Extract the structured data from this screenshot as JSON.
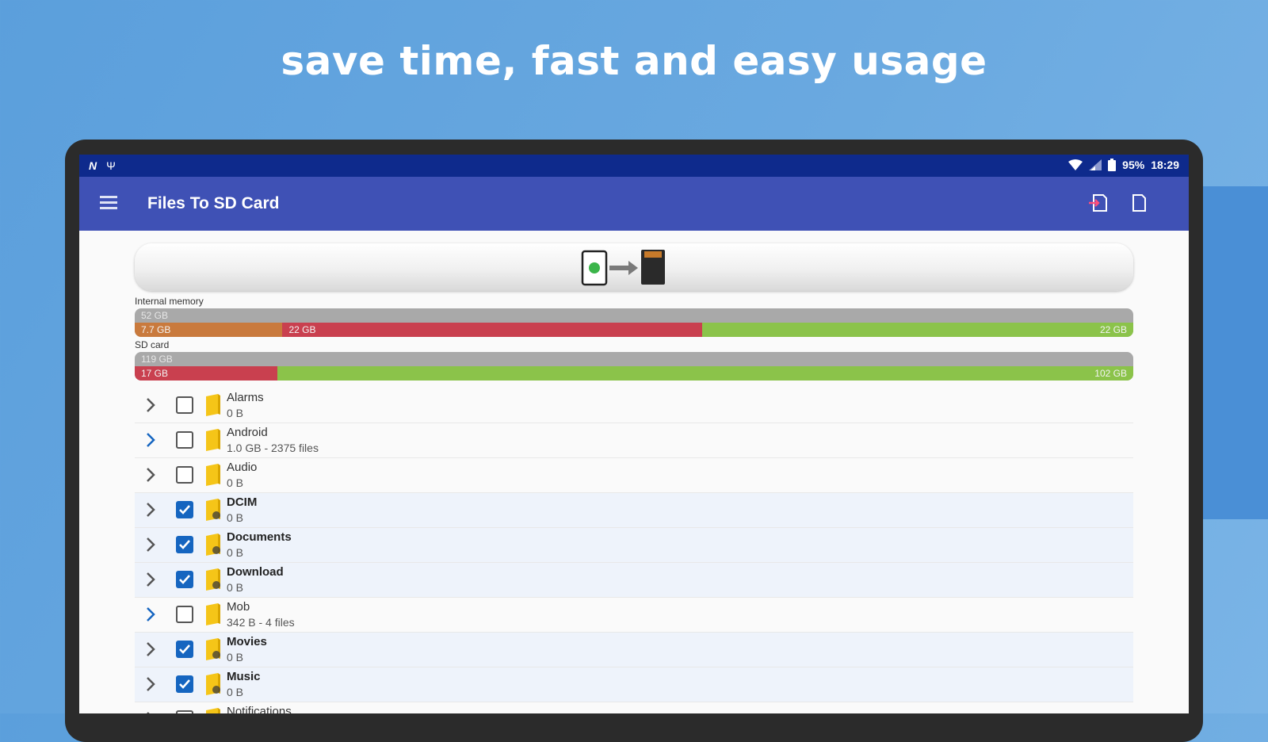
{
  "headline": "save time, fast and easy usage",
  "statusbar": {
    "battery": "95%",
    "time": "18:29",
    "icons": [
      "n-icon",
      "usb-icon",
      "wifi-icon",
      "signal-icon",
      "battery-icon"
    ]
  },
  "appbar": {
    "title": "Files To SD Card",
    "icons": [
      "menu-icon",
      "move-to-sd-icon",
      "sd-card-icon"
    ]
  },
  "colors": {
    "status_bar": "#0e2a8c",
    "app_bar": "#3f51b5",
    "used_other": "#c97a3d",
    "used": "#c9404f",
    "free": "#8bc34a",
    "checkbox_on": "#1565c0",
    "chevron_active": "#1565c0",
    "folder": "#f5c518"
  },
  "storage": {
    "internal": {
      "label": "Internal memory",
      "total": "52 GB",
      "segments": [
        {
          "label": "7.7 GB",
          "fraction": 0.148,
          "kind": "other"
        },
        {
          "label": "22 GB",
          "fraction": 0.42,
          "kind": "used"
        },
        {
          "label": "22 GB",
          "fraction": 0.432,
          "kind": "free"
        }
      ]
    },
    "sd": {
      "label": "SD card",
      "total": "119 GB",
      "segments": [
        {
          "label": "17 GB",
          "fraction": 0.143,
          "kind": "used"
        },
        {
          "label": "102 GB",
          "fraction": 0.857,
          "kind": "free"
        }
      ]
    }
  },
  "folders": [
    {
      "name": "Alarms",
      "size": "0 B",
      "checked": false,
      "expandable": false,
      "badge": ""
    },
    {
      "name": "Android",
      "size": "1.0 GB - 2375 files",
      "checked": false,
      "expandable": true,
      "badge": ""
    },
    {
      "name": "Audio",
      "size": "0 B",
      "checked": false,
      "expandable": false,
      "badge": ""
    },
    {
      "name": "DCIM",
      "size": "0 B",
      "checked": true,
      "expandable": false,
      "badge": "camera"
    },
    {
      "name": "Documents",
      "size": "0 B",
      "checked": true,
      "expandable": false,
      "badge": "document"
    },
    {
      "name": "Download",
      "size": "0 B",
      "checked": true,
      "expandable": false,
      "badge": "download"
    },
    {
      "name": "Mob",
      "size": "342 B - 4 files",
      "checked": false,
      "expandable": true,
      "badge": ""
    },
    {
      "name": "Movies",
      "size": "0 B",
      "checked": true,
      "expandable": false,
      "badge": "movie"
    },
    {
      "name": "Music",
      "size": "0 B",
      "checked": true,
      "expandable": false,
      "badge": "music"
    },
    {
      "name": "Notifications",
      "size": "",
      "checked": false,
      "expandable": false,
      "badge": ""
    }
  ]
}
